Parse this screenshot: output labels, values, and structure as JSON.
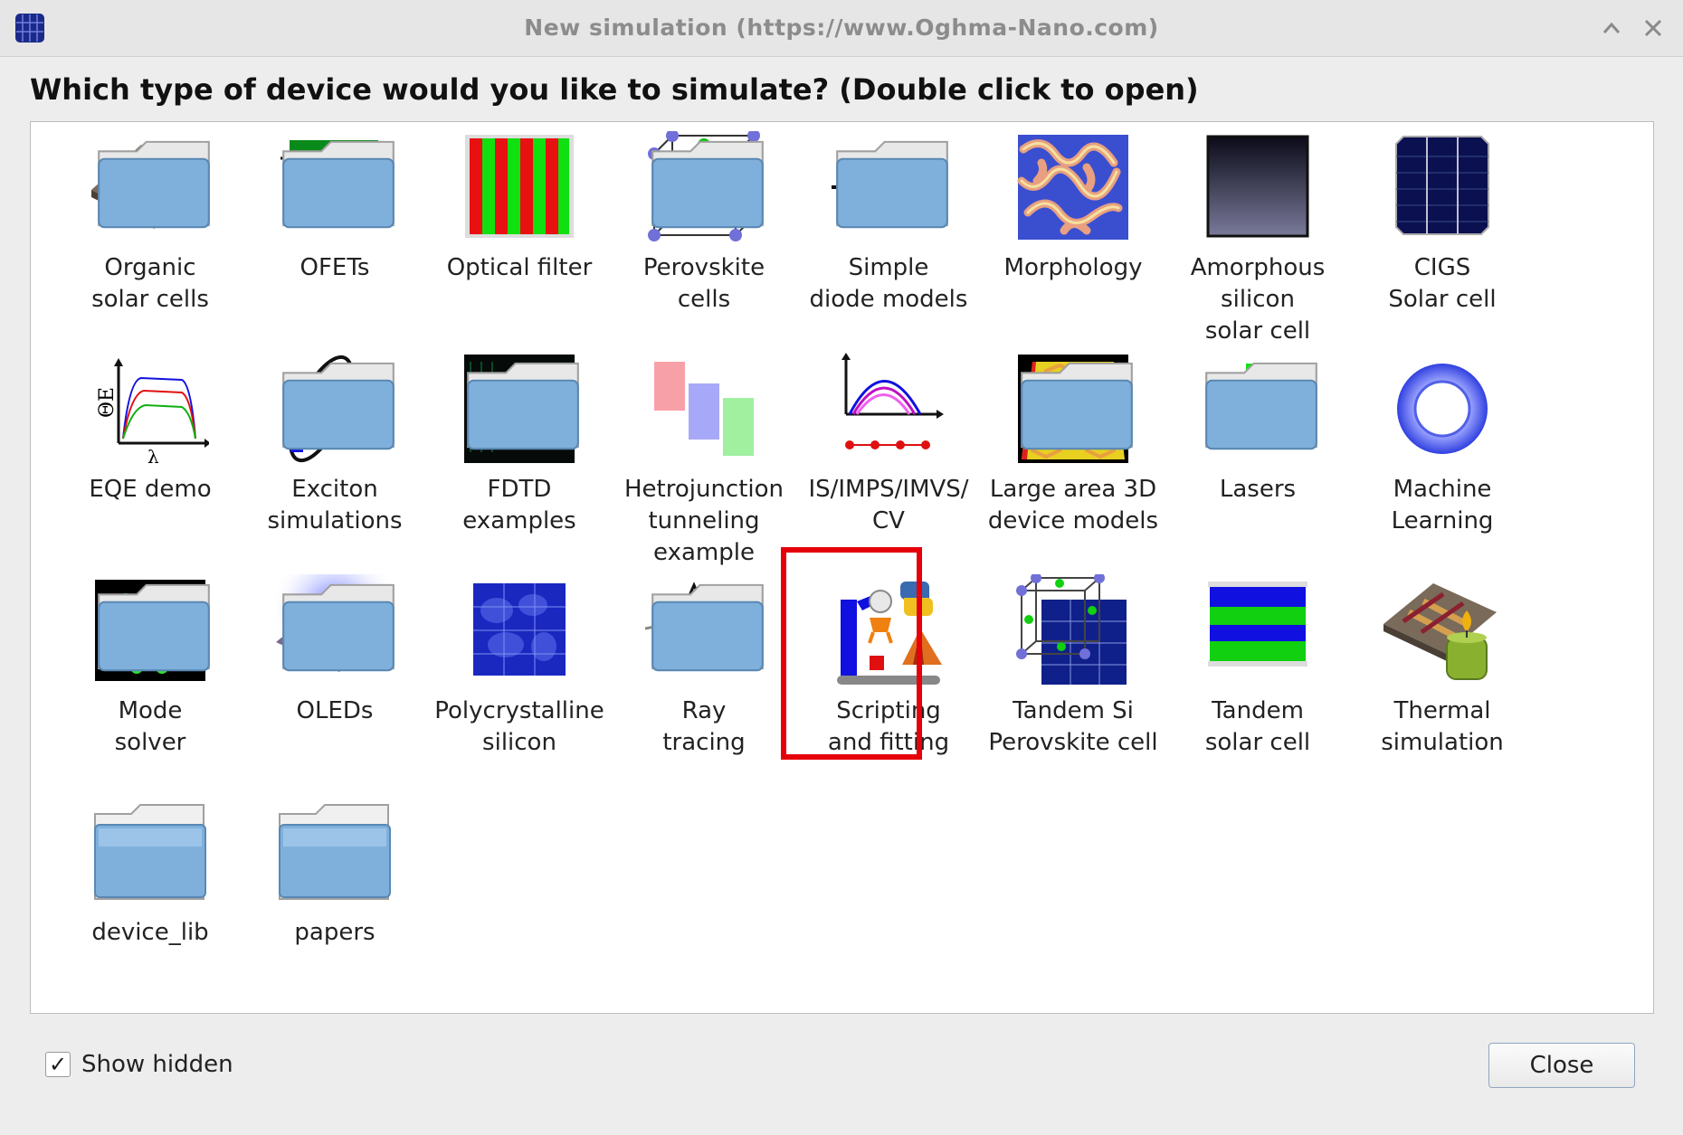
{
  "window": {
    "title": "New simulation (https://www.Oghma-Nano.com)",
    "maximize_glyph": "^",
    "close_glyph": "✕"
  },
  "question": "Which type of device would you like to simulate? (Double click to open)",
  "items": [
    {
      "label": "Organic\nsolar cells",
      "icon": "organic-solar-icon"
    },
    {
      "label": "OFETs",
      "icon": "ofet-icon"
    },
    {
      "label": "Optical filter",
      "icon": "optical-filter-icon"
    },
    {
      "label": "Perovskite\ncells",
      "icon": "perovskite-icon"
    },
    {
      "label": "Simple\ndiode models",
      "icon": "diode-icon"
    },
    {
      "label": "Morphology",
      "icon": "morphology-icon"
    },
    {
      "label": "Amorphous\nsilicon\nsolar cell",
      "icon": "amorphous-silicon-icon"
    },
    {
      "label": "CIGS\nSolar cell",
      "icon": "cigs-icon"
    },
    {
      "label": "EQE demo",
      "icon": "eqe-icon"
    },
    {
      "label": "Exciton\nsimulations",
      "icon": "exciton-icon"
    },
    {
      "label": "FDTD\nexamples",
      "icon": "fdtd-icon"
    },
    {
      "label": "Hetrojunction\ntunneling\nexample",
      "icon": "heterojunction-icon"
    },
    {
      "label": "IS/IMPS/IMVS/\nCV",
      "icon": "impedance-icon"
    },
    {
      "label": "Large area 3D\ndevice models",
      "icon": "large-area-3d-icon"
    },
    {
      "label": "Lasers",
      "icon": "laser-icon"
    },
    {
      "label": "Machine\nLearning",
      "icon": "machine-learning-icon"
    },
    {
      "label": "Mode\nsolver",
      "icon": "mode-solver-icon"
    },
    {
      "label": "OLEDs",
      "icon": "oled-icon"
    },
    {
      "label": "Polycrystalline\nsilicon",
      "icon": "polycrystalline-icon"
    },
    {
      "label": "Ray\ntracing",
      "icon": "ray-tracing-icon"
    },
    {
      "label": "Scripting\nand fitting",
      "icon": "scripting-icon",
      "selected": true
    },
    {
      "label": "Tandem Si\nPerovskite cell",
      "icon": "tandem-si-perovskite-icon"
    },
    {
      "label": "Tandem\nsolar cell",
      "icon": "tandem-solar-icon"
    },
    {
      "label": "Thermal\nsimulation",
      "icon": "thermal-icon"
    },
    {
      "label": "device_lib",
      "icon": "folder-icon"
    },
    {
      "label": "papers",
      "icon": "folder-icon"
    }
  ],
  "footer": {
    "show_hidden_label": "Show hidden",
    "show_hidden_checked": true,
    "check_glyph": "✓",
    "close_label": "Close"
  },
  "colors": {
    "selection_border": "#e5000a",
    "folder_blue": "#7fb0dc"
  }
}
